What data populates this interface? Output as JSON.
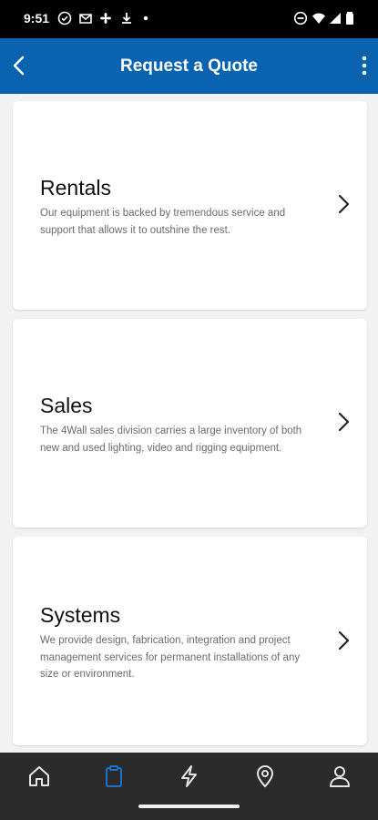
{
  "status_bar": {
    "time": "9:51",
    "left_icons": [
      "check-circle-icon",
      "gmail-icon",
      "fan-icon",
      "download-icon",
      "dot-icon"
    ],
    "right_icons": [
      "do-not-disturb-icon",
      "wifi-icon",
      "signal-icon",
      "battery-icon"
    ]
  },
  "app_bar": {
    "title": "Request a Quote",
    "background": "#0a63b1"
  },
  "cards": [
    {
      "title": "Rentals",
      "description": "Our equipment is backed by tremendous service and support that allows it to outshine the rest."
    },
    {
      "title": "Sales",
      "description": "The 4Wall sales division carries a large inventory of both new and used lighting, video and rigging equipment."
    },
    {
      "title": "Systems",
      "description": "We provide design, fabrication, integration and project management services for permanent installations of any size or environment."
    }
  ],
  "bottom_nav": {
    "items": [
      "home-icon",
      "clipboard-icon",
      "lightning-icon",
      "location-pin-icon",
      "profile-icon"
    ],
    "active_index": 1,
    "active_color": "#1a73c8"
  }
}
